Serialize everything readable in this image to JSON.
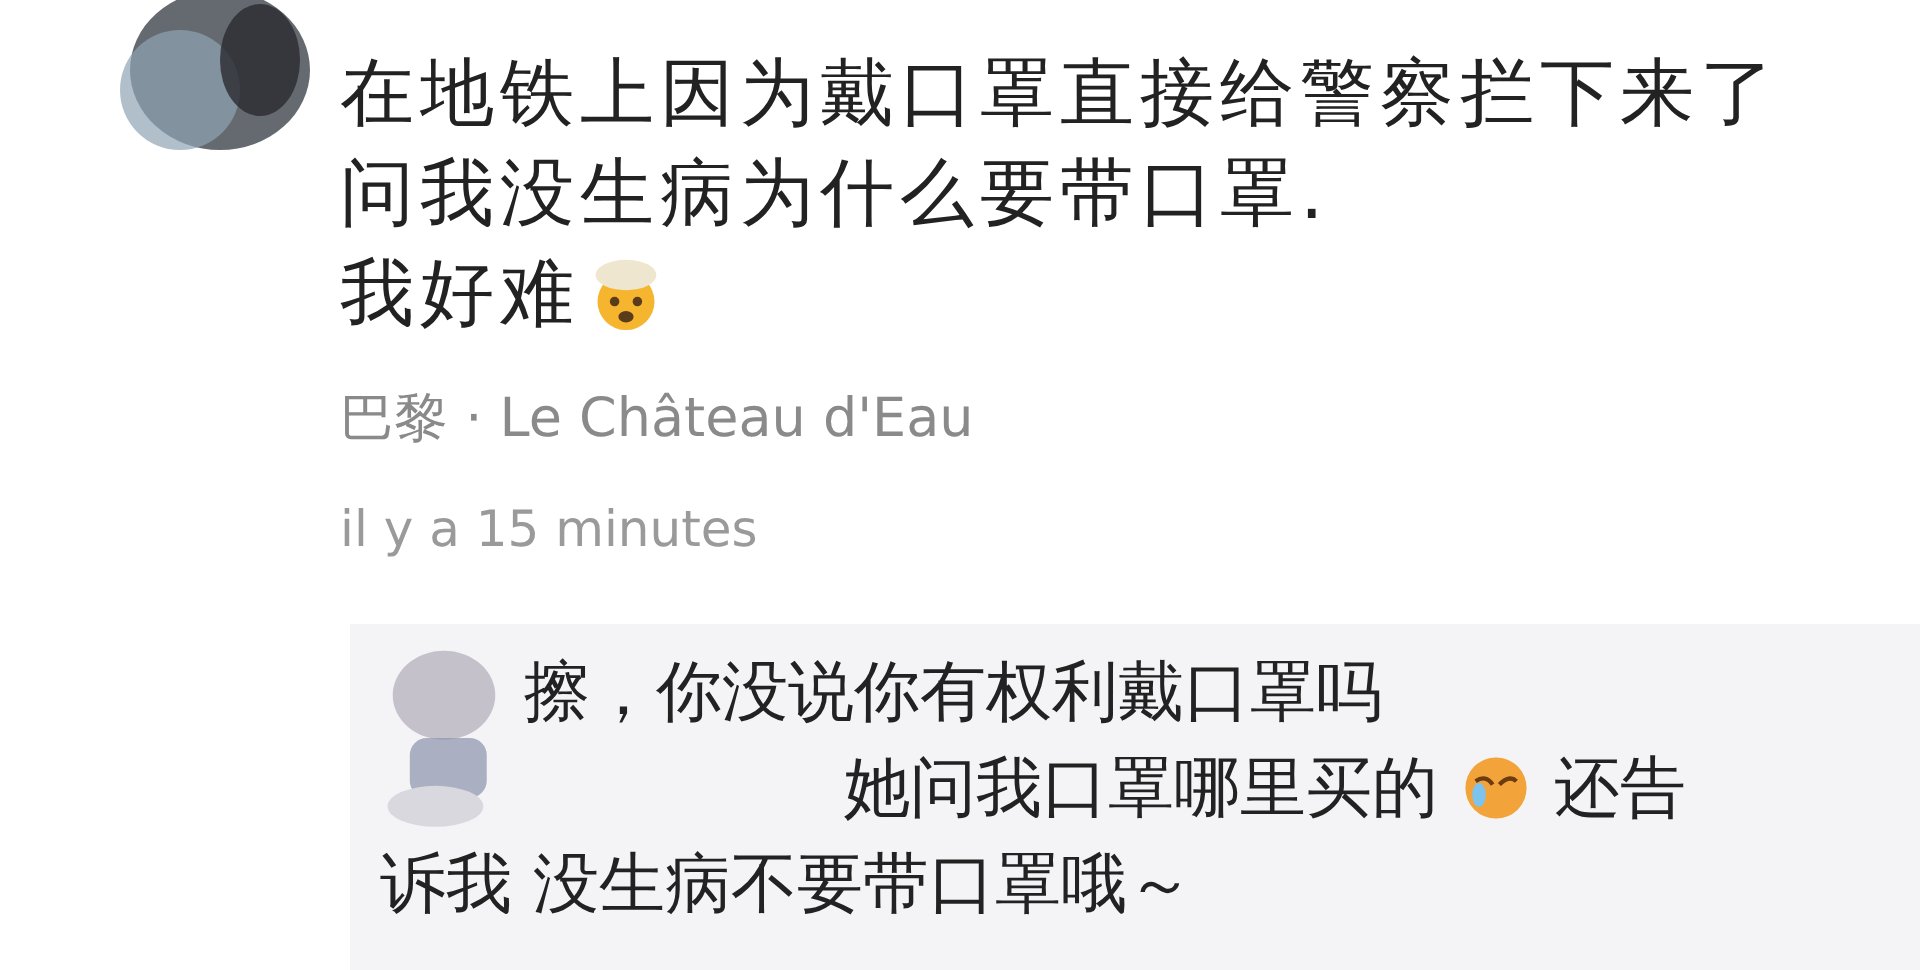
{
  "post": {
    "lines": [
      "在地铁上因为戴口罩直接给警察拦下来了",
      "问我没生病为什么要带口罩.",
      "我好难"
    ],
    "location": "巴黎 · Le Château d'Eau",
    "time": "il y a 15 minutes"
  },
  "comment": {
    "lines": [
      [
        {
          "kind": "text",
          "text": "擦，你没说你有权利戴口罩吗"
        }
      ],
      [
        {
          "kind": "text",
          "text": "她问我口罩哪里买的"
        },
        {
          "kind": "emoji"
        },
        {
          "kind": "text",
          "text": "还告"
        }
      ],
      [
        {
          "kind": "text",
          "text": "诉我 没生病不要带口罩哦～"
        }
      ]
    ]
  }
}
